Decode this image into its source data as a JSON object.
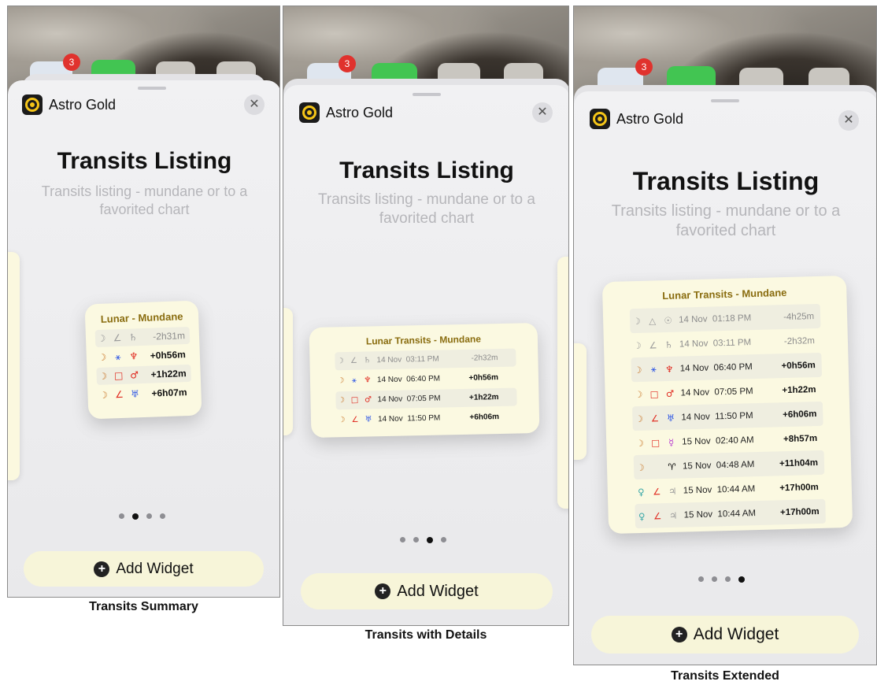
{
  "panels": [
    {
      "app_name": "Astro Gold",
      "close_glyph": "✕",
      "title": "Transits Listing",
      "subtitle_line1": "Transits listing - mundane or to a",
      "subtitle_line2": "favorited chart",
      "badge": "3",
      "widget_title": "Lunar - Mundane",
      "rows": [
        {
          "g1": "☽",
          "g2": "∠",
          "g3": "♄",
          "date": "",
          "offset": "-2h31m",
          "muted": true
        },
        {
          "g1": "☽",
          "g2": "⚹",
          "g3": "♆",
          "date": "",
          "offset": "+0h56m",
          "muted": false
        },
        {
          "g1": "☽",
          "g2": "□",
          "g3": "♂",
          "date": "",
          "offset": "+1h22m",
          "muted": false
        },
        {
          "g1": "☽",
          "g2": "∠",
          "g3": "♅",
          "date": "",
          "offset": "+6h07m",
          "muted": false
        }
      ],
      "page_dots": 4,
      "active_dot": 1,
      "add_button": "Add Widget",
      "caption": "Transits Summary"
    },
    {
      "app_name": "Astro Gold",
      "close_glyph": "✕",
      "title": "Transits Listing",
      "subtitle_line1": "Transits listing - mundane or to a",
      "subtitle_line2": "favorited chart",
      "badge": "3",
      "widget_title": "Lunar Transits - Mundane",
      "rows": [
        {
          "g1": "☽",
          "g2": "∠",
          "g3": "♄",
          "date": "14 Nov  03:11 PM",
          "offset": "-2h32m",
          "muted": true
        },
        {
          "g1": "☽",
          "g2": "⚹",
          "g3": "♆",
          "date": "14 Nov  06:40 PM",
          "offset": "+0h56m",
          "muted": false
        },
        {
          "g1": "☽",
          "g2": "□",
          "g3": "♂",
          "date": "14 Nov  07:05 PM",
          "offset": "+1h22m",
          "muted": false
        },
        {
          "g1": "☽",
          "g2": "∠",
          "g3": "♅",
          "date": "14 Nov  11:50 PM",
          "offset": "+6h06m",
          "muted": false
        }
      ],
      "page_dots": 4,
      "active_dot": 2,
      "add_button": "Add Widget",
      "caption": "Transits with Details"
    },
    {
      "app_name": "Astro Gold",
      "close_glyph": "✕",
      "title": "Transits Listing",
      "subtitle_line1": "Transits listing - mundane or to a",
      "subtitle_line2": "favorited chart",
      "badge": "3",
      "widget_title": "Lunar Transits - Mundane",
      "rows": [
        {
          "g1": "☽",
          "g2": "△",
          "g3": "☉",
          "date": "14 Nov  01:18 PM",
          "offset": "-4h25m",
          "muted": true
        },
        {
          "g1": "☽",
          "g2": "∠",
          "g3": "♄",
          "date": "14 Nov  03:11 PM",
          "offset": "-2h32m",
          "muted": true
        },
        {
          "g1": "☽",
          "g2": "⚹",
          "g3": "♆",
          "date": "14 Nov  06:40 PM",
          "offset": "+0h56m",
          "muted": false
        },
        {
          "g1": "☽",
          "g2": "□",
          "g3": "♂",
          "date": "14 Nov  07:05 PM",
          "offset": "+1h22m",
          "muted": false
        },
        {
          "g1": "☽",
          "g2": "∠",
          "g3": "♅",
          "date": "14 Nov  11:50 PM",
          "offset": "+6h06m",
          "muted": false
        },
        {
          "g1": "☽",
          "g2": "□",
          "g3": "☿",
          "date": "15 Nov  02:40 AM",
          "offset": "+8h57m",
          "muted": false
        },
        {
          "g1": "☽",
          "g2": "",
          "g3": "♈",
          "date": "15 Nov  04:48 AM",
          "offset": "+11h04m",
          "muted": false
        },
        {
          "g1": "♀",
          "g2": "∠",
          "g3": "♃",
          "date": "15 Nov  10:44 AM",
          "offset": "+17h00m",
          "muted": false
        },
        {
          "g1": "♀",
          "g2": "∠",
          "g3": "♃",
          "date": "15 Nov  10:44 AM",
          "offset": "+17h00m",
          "muted": false
        }
      ],
      "page_dots": 4,
      "active_dot": 3,
      "add_button": "Add Widget",
      "caption": "Transits Extended"
    }
  ],
  "colors": {
    "widget_bg": "#fbf9e1",
    "widget_title": "#8a6d10",
    "moon": "#c9772a",
    "aspect_red": "#e0281e",
    "planet_blue": "#2f57e5",
    "venus_green": "#3aa8a8",
    "mercury_purple": "#b93fd0"
  }
}
